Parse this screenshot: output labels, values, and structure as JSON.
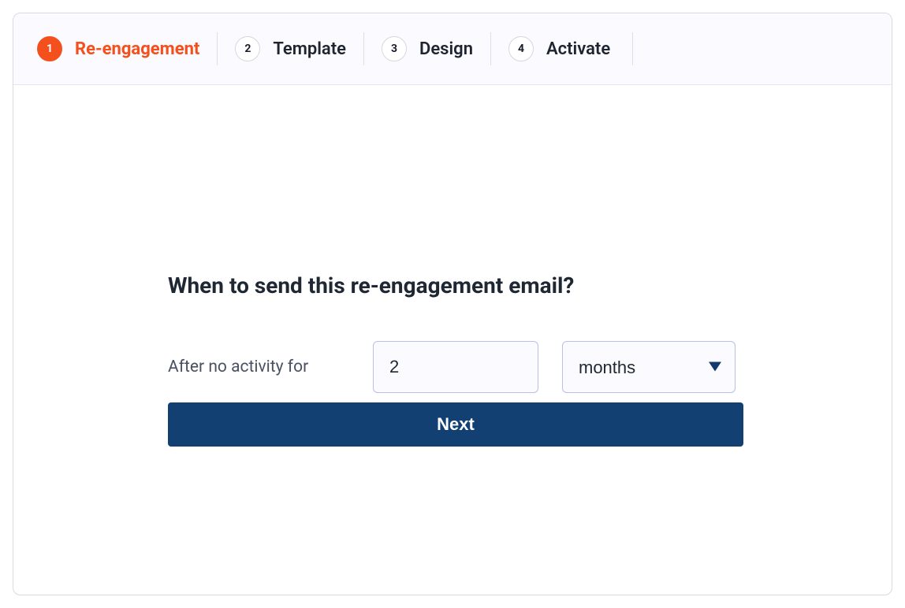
{
  "stepper": {
    "steps": [
      {
        "num": "1",
        "label": "Re-engagement",
        "active": true
      },
      {
        "num": "2",
        "label": "Template",
        "active": false
      },
      {
        "num": "3",
        "label": "Design",
        "active": false
      },
      {
        "num": "4",
        "label": "Activate",
        "active": false
      }
    ]
  },
  "content": {
    "heading": "When to send this re-engagement email?",
    "lead_text": "After no activity for",
    "duration_value": "2",
    "unit_selected": "months",
    "next_button_label": "Next"
  }
}
